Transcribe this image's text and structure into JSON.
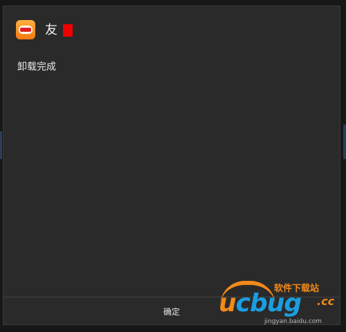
{
  "dialog": {
    "title": "友",
    "message": "卸载完成",
    "ok_label": "确定"
  },
  "icons": {
    "app_icon": "app-icon",
    "redaction": "red-redaction-box"
  },
  "watermark": {
    "site_name": "软件下载站",
    "logo_u": "u",
    "logo_c": "c",
    "logo_bug": "bug",
    "logo_tld": ".cc",
    "url": "jingyan.baidu.com"
  },
  "colors": {
    "dialog_bg": "#2a2a2a",
    "text": "#f2f2f2",
    "accent_orange": "#f08a1a",
    "accent_blue": "#1a9ee0",
    "redaction": "#ee0000"
  }
}
